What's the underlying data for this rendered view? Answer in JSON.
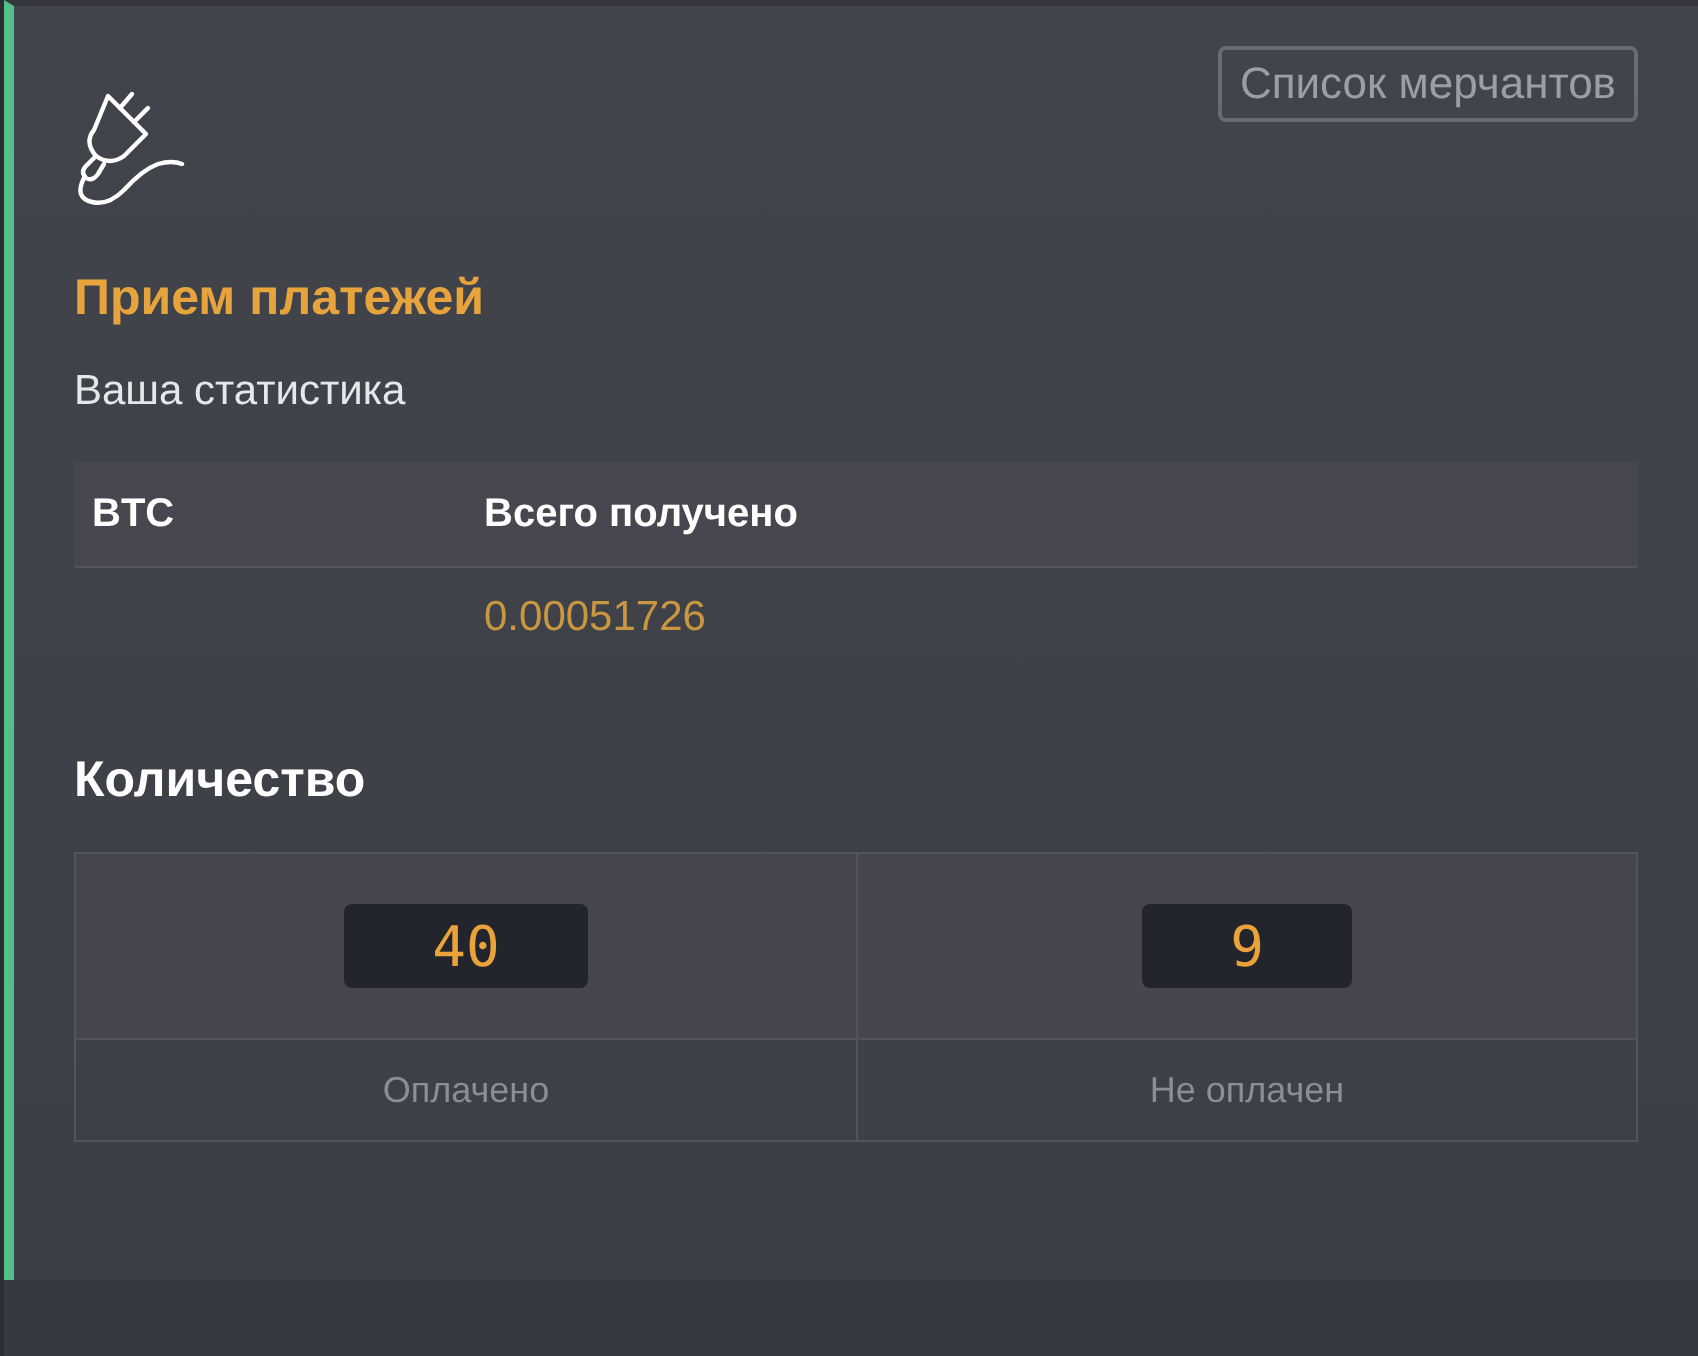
{
  "header": {
    "merchants_button": "Список мерчантов",
    "title": "Прием платежей",
    "subtitle": "Ваша статистика"
  },
  "totals_table": {
    "columns": [
      "BTC",
      "Всего получено"
    ],
    "rows": [
      {
        "total_received": "0.00051726"
      }
    ]
  },
  "counts": {
    "title": "Количество",
    "items": [
      {
        "value": "40",
        "label": "Оплачено"
      },
      {
        "value": "9",
        "label": "Не оплачен"
      }
    ]
  }
}
